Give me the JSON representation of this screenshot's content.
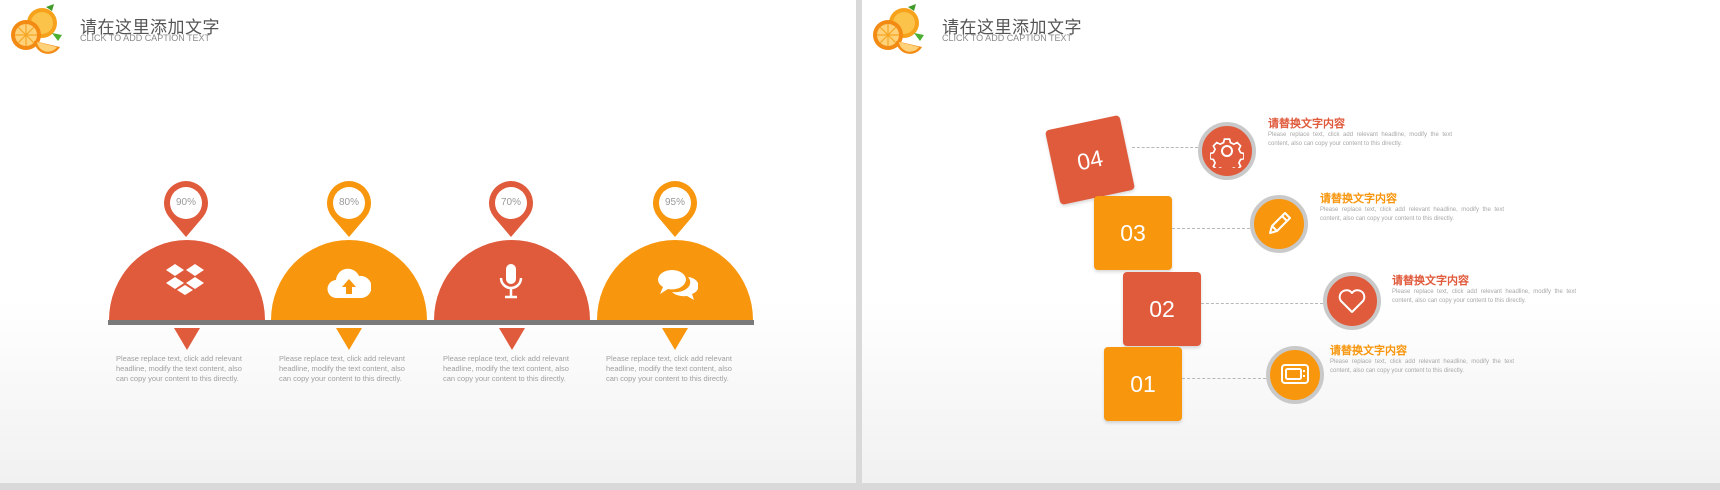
{
  "colors": {
    "red": "#e05a3c",
    "orange": "#f8960d",
    "line": "#7a7a7a",
    "gray_text": "#a0a0a0"
  },
  "slide1": {
    "title": "请在这里添加文字",
    "subtitle": "CLICK TO ADD CAPTION TEXT",
    "items": [
      {
        "percent": "90%",
        "icon": "dropbox-icon",
        "color": "red",
        "text": "Please replace text, click add relevant headline, modify the text content, also can copy your content to this directly."
      },
      {
        "percent": "80%",
        "icon": "cloud-upload-icon",
        "color": "orange",
        "text": "Please replace text, click add relevant headline, modify the text content, also can copy your content to this directly."
      },
      {
        "percent": "70%",
        "icon": "microphone-icon",
        "color": "red",
        "text": "Please replace text, click add relevant headline, modify the text content, also can copy your content to this directly."
      },
      {
        "percent": "95%",
        "icon": "chat-icon",
        "color": "orange",
        "text": "Please replace text, click add relevant headline, modify the text content, also can copy your content to this directly."
      }
    ]
  },
  "slide2": {
    "title": "请在这里添加文字",
    "subtitle": "CLICK TO ADD CAPTION TEXT",
    "steps": [
      {
        "number": "04",
        "icon": "gear-icon",
        "color": "red",
        "title": "请替换文字内容",
        "text": "Please replace text, click add relevant headline, modify the text content, also can copy your content to this directly."
      },
      {
        "number": "03",
        "icon": "pencil-icon",
        "color": "orange",
        "title": "请替换文字内容",
        "text": "Please replace text, click add relevant headline, modify the text content, also can copy your content to this directly."
      },
      {
        "number": "02",
        "icon": "heart-icon",
        "color": "red",
        "title": "请替换文字内容",
        "text": "Please replace text, click add relevant headline, modify the text content, also can copy your content to this directly."
      },
      {
        "number": "01",
        "icon": "tv-icon",
        "color": "orange",
        "title": "请替换文字内容",
        "text": "Please replace text, click add relevant headline, modify the text content, also can copy your content to this directly."
      }
    ]
  }
}
